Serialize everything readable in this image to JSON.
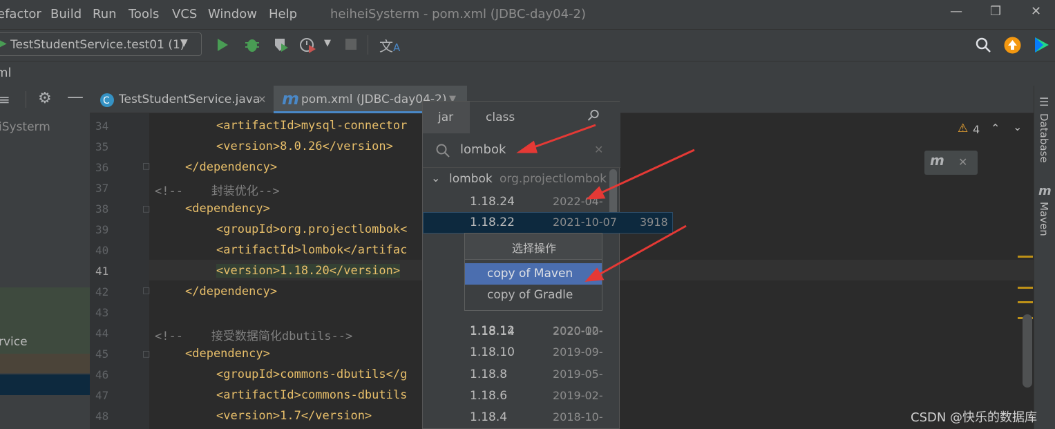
{
  "menubar": {
    "items": [
      "efactor",
      "Build",
      "Run",
      "Tools",
      "VCS",
      "Window",
      "Help"
    ],
    "title": "heiheiSysterm - pom.xml (JDBC-day04-2)"
  },
  "toolbar": {
    "run_config": "TestStudentService.test01 (1)"
  },
  "breadcrumb": {
    "file": "ml"
  },
  "project_panel": {
    "root": "iSysterm",
    "selected_item": "rvice"
  },
  "tabs": [
    {
      "label": "TestStudentService.java"
    },
    {
      "label": "pom.xml (JDBC-day04-2)"
    }
  ],
  "editor": {
    "warnings": "4",
    "lines": [
      {
        "n": "34",
        "text": "<artifactId>mysql-connector"
      },
      {
        "n": "35",
        "text": "<version>8.0.26</version>"
      },
      {
        "n": "36",
        "text": "</dependency>"
      },
      {
        "n": "37",
        "text": "<!--    封装优化-->"
      },
      {
        "n": "38",
        "text": "<dependency>"
      },
      {
        "n": "39",
        "text": "<groupId>org.projectlombok<"
      },
      {
        "n": "40",
        "text": "<artifactId>lombok</artifac"
      },
      {
        "n": "41",
        "text": "<version>1.18.20</version>"
      },
      {
        "n": "42",
        "text": "</dependency>"
      },
      {
        "n": "43",
        "text": ""
      },
      {
        "n": "44",
        "text": "<!--    接受数据简化dbutils-->"
      },
      {
        "n": "45",
        "text": "<dependency>"
      },
      {
        "n": "46",
        "text": "<groupId>commons-dbutils</g"
      },
      {
        "n": "47",
        "text": "<artifactId>commons-dbutils"
      },
      {
        "n": "48",
        "text": "<version>1.7</version>"
      }
    ]
  },
  "search_popup": {
    "tab_jar": "jar",
    "tab_class": "class",
    "query": "lombok",
    "group": {
      "name": "lombok",
      "group_id": "org.projectlombok"
    },
    "versions": [
      {
        "version": "1.18.24",
        "date": "2022-04-"
      },
      {
        "version": "1.18.22",
        "date": "2021-10-07",
        "count": "3918"
      },
      {
        "version": "1.18.14",
        "date": "2020-10-"
      },
      {
        "version": "1.18.12",
        "date": "2020-02-"
      },
      {
        "version": "1.18.10",
        "date": "2019-09-"
      },
      {
        "version": "1.18.8",
        "date": "2019-05-"
      },
      {
        "version": "1.18.6",
        "date": "2019-02-"
      },
      {
        "version": "1.18.4",
        "date": "2018-10-"
      }
    ]
  },
  "context_menu": {
    "title": "选择操作",
    "items": [
      "copy of Maven",
      "copy of Gradle"
    ]
  },
  "right_strip": {
    "database": "Database",
    "maven": "Maven"
  },
  "watermark": "CSDN @快乐的数据库",
  "colors": {
    "accent": "#4b6eaf",
    "selected_row": "#0d293e",
    "arrow": "#e53935"
  }
}
